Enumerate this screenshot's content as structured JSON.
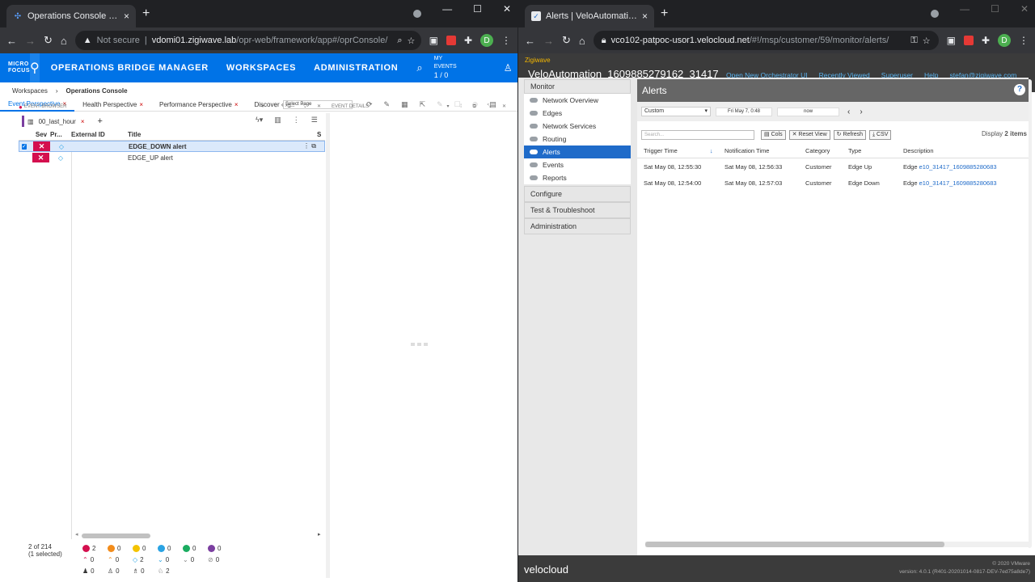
{
  "left_browser": {
    "tab_title": "Operations Console - Operation",
    "url_secure": "Not secure",
    "url_host": "vdomi01.zigiwave.lab",
    "url_path": "/opr-web/framework/app#/oprConsole/",
    "profile": "D"
  },
  "obm": {
    "logo_line1": "MICRO",
    "logo_line2": "FOCUS",
    "nav": [
      "OPERATIONS BRIDGE MANAGER",
      "WORKSPACES",
      "ADMINISTRATION"
    ],
    "my_events_label": "MY EVENTS",
    "my_events_count": "1 / 0",
    "breadcrumb": [
      "Workspaces",
      "Operations Console"
    ],
    "tabs": [
      "Event Perspective",
      "Health Perspective",
      "Performance Perspective",
      "Discover"
    ],
    "tab_more": "...",
    "select_page": "Select Page",
    "event_browser_label": "EVENT BROWSER",
    "event_details_label": "EVENT DETAILS",
    "filter_name": "00_last_hour",
    "columns": [
      "Sev",
      "Pr...",
      "External ID",
      "Title",
      "S"
    ],
    "rows": [
      {
        "title": "EDGE_DOWN alert",
        "severity": "critical",
        "selected": true
      },
      {
        "title": "EDGE_UP alert",
        "severity": "critical",
        "selected": false
      }
    ],
    "status_count": "2 of 214",
    "status_selected": "(1 selected)",
    "counts_row1": [
      "2",
      "0",
      "0",
      "0",
      "0",
      "0"
    ],
    "counts_row2": [
      "0",
      "0",
      "2",
      "0",
      "0",
      "0"
    ],
    "counts_row3": [
      "0",
      "0",
      "0",
      "2"
    ],
    "colors": {
      "critical": "#d40f4e",
      "brand": "#0073e7"
    }
  },
  "right_browser": {
    "tab_title": "Alerts | VeloAutomation_160988",
    "url_host": "vco102-patpoc-usor1.velocloud.net",
    "url_path": "/#!/msp/customer/59/monitor/alerts/",
    "profile": "D"
  },
  "velo": {
    "partner": "Zigiwave",
    "enterprise": "VeloAutomation_1609885279162_31417",
    "top_links": [
      "Open New Orchestrator UI",
      "Recently Viewed",
      "Superuser",
      "Help",
      "stefan@zigiwave.com"
    ],
    "sidebar": {
      "monitor": "Monitor",
      "items": [
        "Network Overview",
        "Edges",
        "Network Services",
        "Routing",
        "Alerts",
        "Events",
        "Reports"
      ],
      "active": "Alerts",
      "sections": [
        "Configure",
        "Test & Troubleshoot",
        "Administration"
      ]
    },
    "page_title": "Alerts",
    "help_icon": "?",
    "range_select": "Custom",
    "range_from": "Fri May 7, 0:48",
    "range_to": "now",
    "search_placeholder": "Search...",
    "buttons": [
      "Cols",
      "Reset View",
      "Refresh",
      "CSV"
    ],
    "display_prefix": "Display",
    "display_count": "2 items",
    "columns": [
      "Trigger Time",
      "Notification Time",
      "Category",
      "Type",
      "Description"
    ],
    "rows": [
      {
        "trigger": "Sat May 08, 12:55:30",
        "notif": "Sat May 08, 12:56:33",
        "category": "Customer",
        "type": "Edge Up",
        "desc_prefix": "Edge ",
        "desc_link": "e10_31417_1609885280683"
      },
      {
        "trigger": "Sat May 08, 12:54:00",
        "notif": "Sat May 08, 12:57:03",
        "category": "Customer",
        "type": "Edge Down",
        "desc_prefix": "Edge ",
        "desc_link": "e10_31417_1609885280683"
      }
    ],
    "footer_brand": "velocloud",
    "footer_copy": "© 2020 VMware",
    "footer_version": "version: 4.0.1 (R401-20201014-0817-DEV-7ed75a8de7)"
  }
}
